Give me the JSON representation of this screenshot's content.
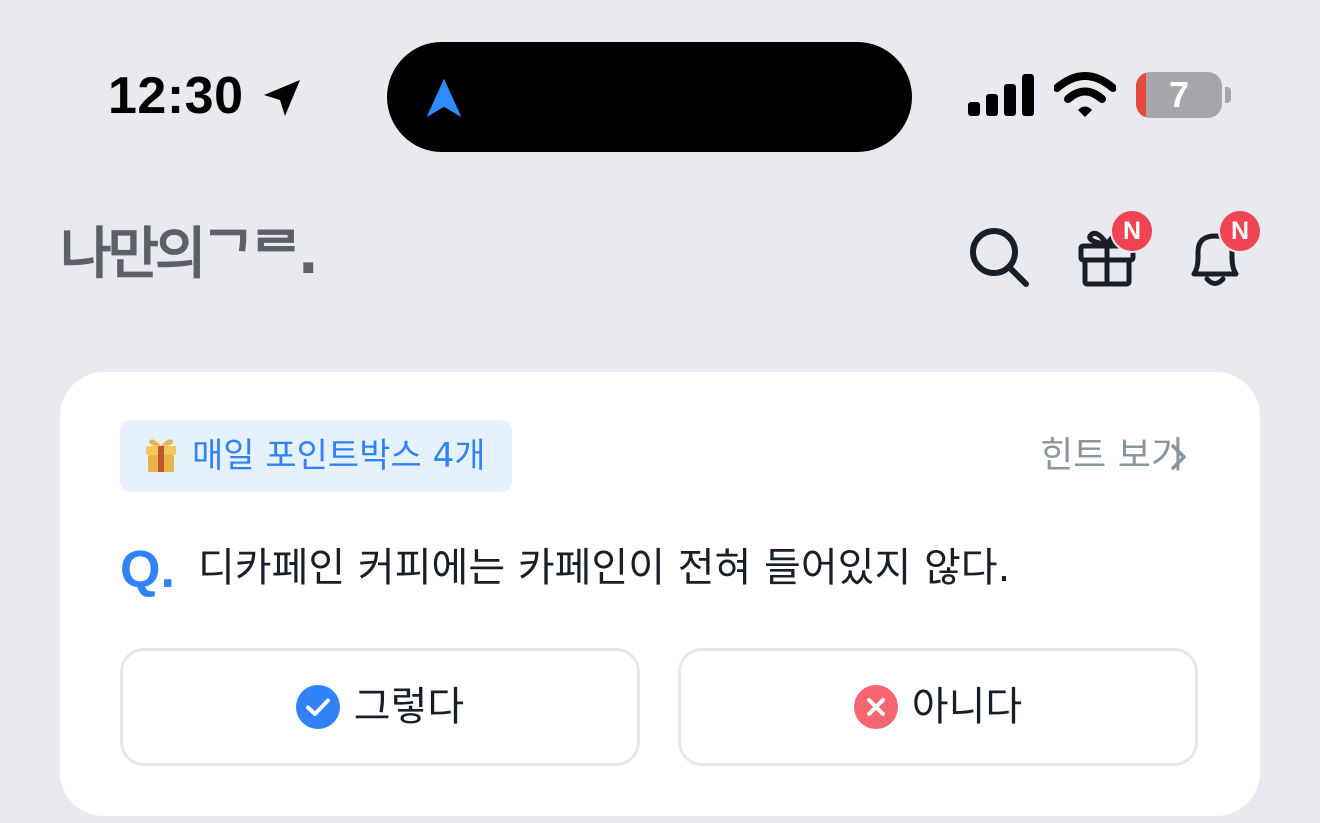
{
  "status_bar": {
    "time": "12:30",
    "battery_level": "7",
    "icons": [
      "location-arrow-icon",
      "navigation-arrow-icon",
      "cellular-signal-icon",
      "wifi-icon",
      "battery-icon"
    ]
  },
  "header": {
    "logo_text": "나만의ᄀᄅ.",
    "search_icon": "search-icon",
    "gift_icon": "gift-icon",
    "gift_badge": "N",
    "bell_icon": "bell-icon",
    "bell_badge": "N"
  },
  "quiz": {
    "points_chip_icon": "gift-emoji-icon",
    "points_chip_label": "매일 포인트박스 4개",
    "hint_label": "힌트 보기",
    "question_prefix": "Q.",
    "question": "디카페인 커피에는 카페인이 전혀 들어있지 않다.",
    "answers": [
      {
        "label": "그렇다",
        "icon": "check-circle-icon"
      },
      {
        "label": "아니다",
        "icon": "x-circle-icon"
      }
    ]
  },
  "colors": {
    "background": "#E9EAF0",
    "accent_blue": "#3182F6",
    "badge_red": "#F04452",
    "chip_bg": "#E6F1FE",
    "wrong_red": "#F66570"
  }
}
